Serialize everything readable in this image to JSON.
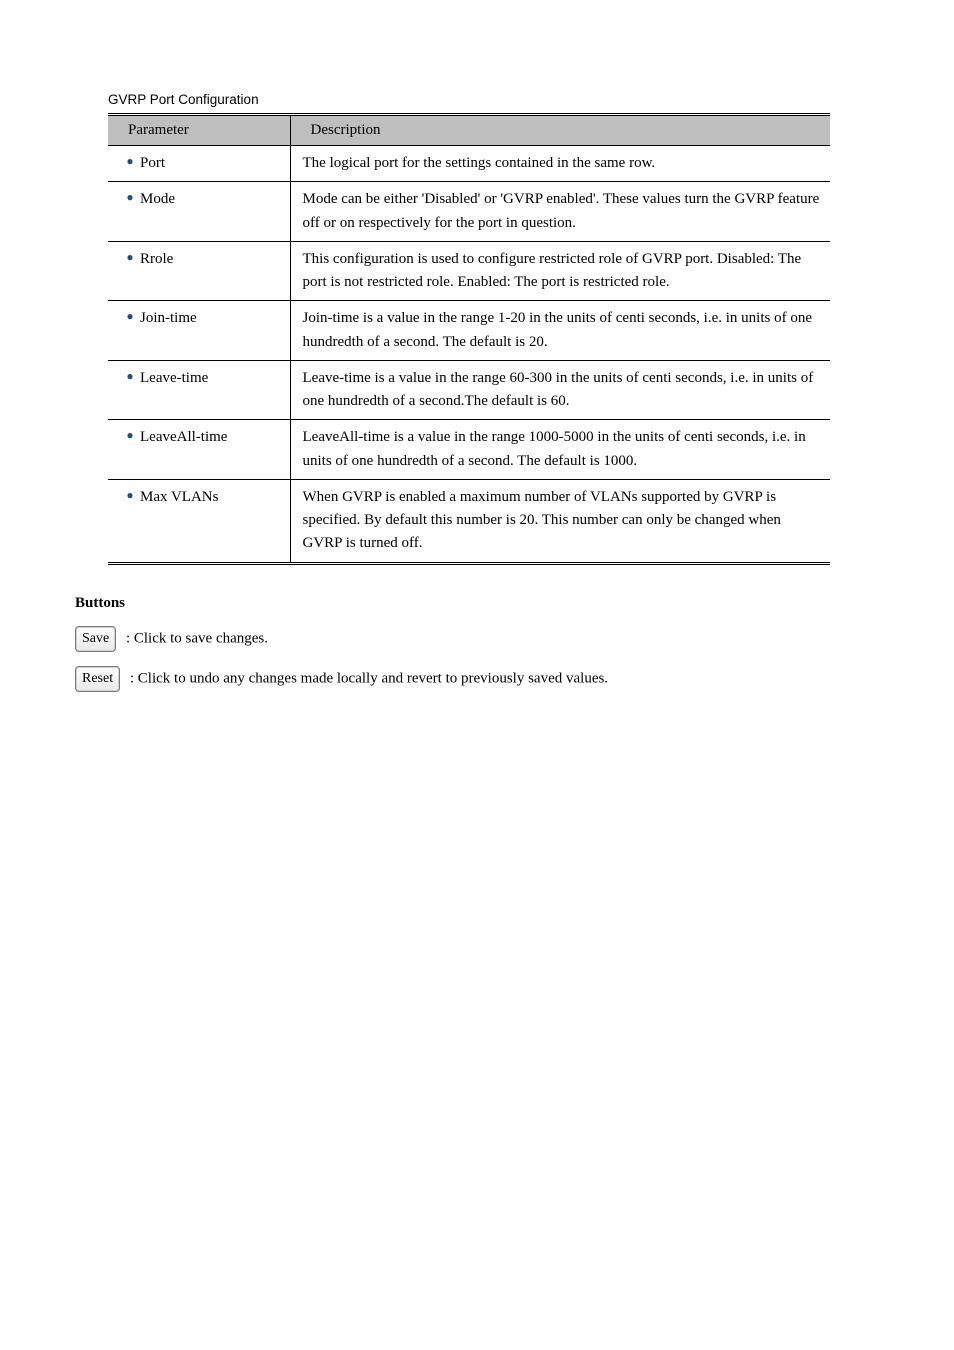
{
  "section_title": "GVRP Port Configuration",
  "table": {
    "header_parameter": "Parameter",
    "header_description": "Description",
    "rows": [
      {
        "param": "Port",
        "desc": "The logical port for the settings contained in the same row."
      },
      {
        "param": "Mode",
        "desc": "Mode can be either 'Disabled' or 'GVRP enabled'. These values turn the GVRP feature off or on respectively for the port in question."
      },
      {
        "param": "Rrole",
        "desc": "This configuration is used to configure restricted role of GVRP port. Disabled: The port is not restricted role. Enabled: The port is restricted role."
      },
      {
        "param": "Join-time",
        "desc": "Join-time is a value in the range 1-20 in the units of centi seconds, i.e. in units of one hundredth of a second. The default is 20."
      },
      {
        "param": "Leave-time",
        "desc": "Leave-time is a value in the range 60-300 in the units of centi seconds, i.e. in units of one hundredth of a second.The default is 60."
      },
      {
        "param": "LeaveAll-time",
        "desc": "LeaveAll-time is a value in the range 1000-5000 in the units of centi seconds, i.e. in units of one hundredth of a second. The default is 1000."
      },
      {
        "param": "Max VLANs",
        "desc": "When GVRP is enabled a maximum number of VLANs supported by GVRP is specified. By default this number is 20. This number can only be changed when GVRP is turned off."
      }
    ]
  },
  "buttons": {
    "title": "Buttons",
    "save_label": "Save",
    "save_desc": ": Click to save changes.",
    "reset_label": "Reset",
    "reset_desc": ": Click to undo any changes made locally and revert to previously saved values."
  }
}
